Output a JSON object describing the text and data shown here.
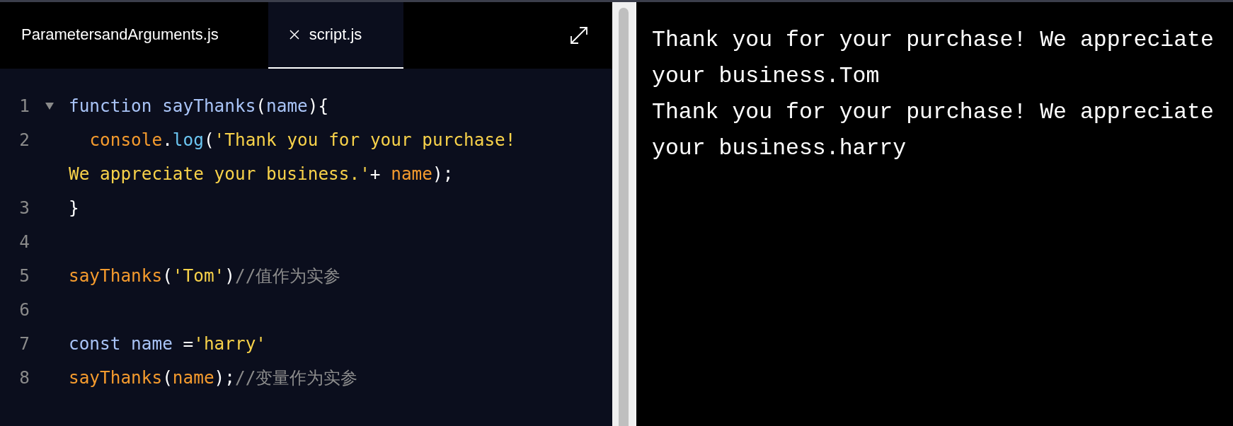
{
  "tabs": [
    {
      "label": "ParametersandArguments.js",
      "selected": false,
      "closable": false
    },
    {
      "label": "script.js",
      "selected": true,
      "closable": true
    }
  ],
  "editor": {
    "lines": [
      {
        "number": "1",
        "foldable": true,
        "tokens": [
          {
            "kind": "keyword",
            "text": "function "
          },
          {
            "kind": "def",
            "text": "sayThanks"
          },
          {
            "kind": "punct",
            "text": "("
          },
          {
            "kind": "keyword",
            "text": "name"
          },
          {
            "kind": "punct",
            "text": "){"
          }
        ]
      },
      {
        "number": "2",
        "foldable": false,
        "tokens": [
          {
            "kind": "call",
            "text": "  console"
          },
          {
            "kind": "punct",
            "text": "."
          },
          {
            "kind": "prop",
            "text": "log"
          },
          {
            "kind": "punct",
            "text": "("
          },
          {
            "kind": "string",
            "text": "'Thank you for your purchase! We appreciate your business.'"
          },
          {
            "kind": "punct",
            "text": "+ "
          },
          {
            "kind": "call",
            "text": "name"
          },
          {
            "kind": "punct",
            "text": ");"
          }
        ]
      },
      {
        "number": "3",
        "foldable": false,
        "tokens": [
          {
            "kind": "punct",
            "text": "}"
          }
        ]
      },
      {
        "number": "4",
        "foldable": false
      },
      {
        "number": "5",
        "foldable": false,
        "tokens": [
          {
            "kind": "call",
            "text": "sayThanks"
          },
          {
            "kind": "punct",
            "text": "("
          },
          {
            "kind": "string",
            "text": "'Tom'"
          },
          {
            "kind": "punct",
            "text": ")"
          },
          {
            "kind": "comment",
            "text": "//值作为实参"
          }
        ]
      },
      {
        "number": "6",
        "foldable": false
      },
      {
        "number": "7",
        "foldable": false,
        "tokens": [
          {
            "kind": "keyword",
            "text": "const name "
          },
          {
            "kind": "punct",
            "text": "="
          },
          {
            "kind": "string",
            "text": "'harry'"
          }
        ]
      },
      {
        "number": "8",
        "foldable": false,
        "tokens": [
          {
            "kind": "call",
            "text": "sayThanks"
          },
          {
            "kind": "punct",
            "text": "("
          },
          {
            "kind": "call",
            "text": "name"
          },
          {
            "kind": "punct",
            "text": ");"
          },
          {
            "kind": "comment",
            "text": "//变量作为实参"
          }
        ]
      }
    ]
  },
  "console": {
    "lines": [
      "Thank you for your purchase! We appreciate your business.Tom",
      "Thank you for your purchase! We appreciate your business.harry"
    ]
  }
}
